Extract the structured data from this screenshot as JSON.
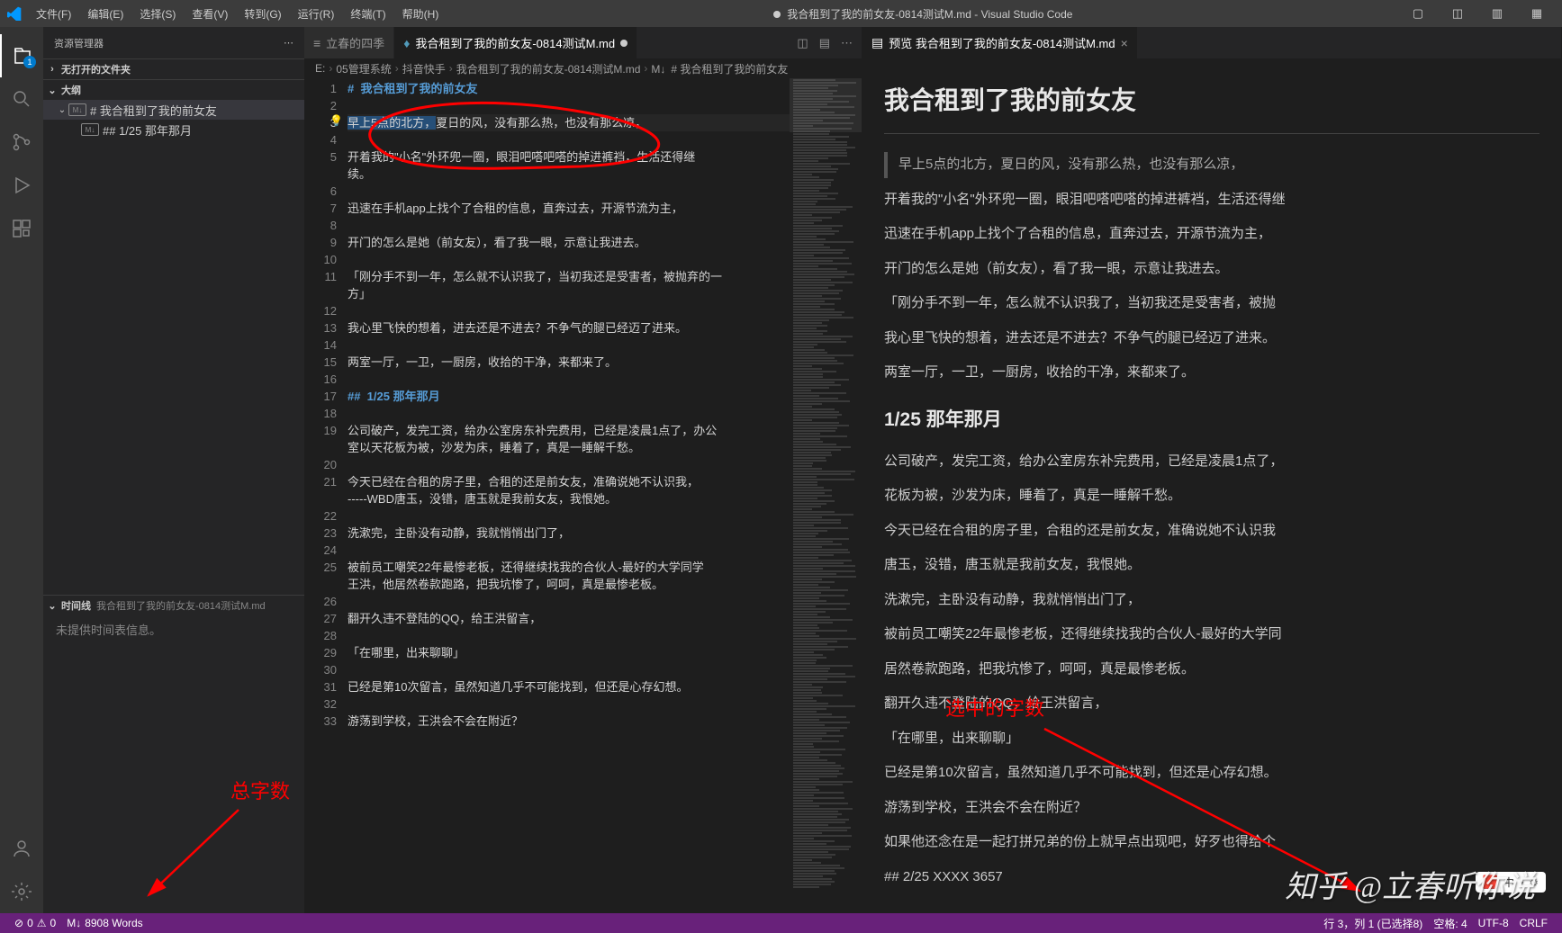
{
  "titlebar": {
    "menus": [
      "文件(F)",
      "编辑(E)",
      "选择(S)",
      "查看(V)",
      "转到(G)",
      "运行(R)",
      "终端(T)",
      "帮助(H)"
    ],
    "title": "我合租到了我的前女友-0814测试M.md - Visual Studio Code",
    "dirty": true
  },
  "activitybar": {
    "explorer_badge": "1"
  },
  "sidebar": {
    "title": "资源管理器",
    "sections": {
      "no_open_folder": "无打开的文件夹",
      "outline": "大纲",
      "timeline": "时间线",
      "timeline_file": "我合租到了我的前女友-0814测试M.md",
      "timeline_empty": "未提供时间表信息。"
    },
    "outline_items": [
      {
        "level": 0,
        "label": "# 我合租到了我的前女友"
      },
      {
        "level": 1,
        "label": "## 1/25 那年那月"
      }
    ]
  },
  "tabs": {
    "inactive": "立春的四季",
    "active": "我合租到了我的前女友-0814测试M.md",
    "preview": "预览 我合租到了我的前女友-0814测试M.md"
  },
  "breadcrumb": [
    "E:",
    "05管理系统",
    "抖音快手",
    "我合租到了我的前女友-0814测试M.md",
    "# 我合租到了我的前女友"
  ],
  "editor": {
    "lines": [
      {
        "n": 1,
        "cls": "h",
        "text": "#  我合租到了我的前女友"
      },
      {
        "n": 2,
        "text": ""
      },
      {
        "n": 3,
        "text_before": "",
        "sel": "早上5点的北方，",
        "text_after": "夏日的风，没有那么热，也没有那么凉，",
        "current": true
      },
      {
        "n": 4,
        "text": ""
      },
      {
        "n": 5,
        "text": "开着我的\"小名\"外环兜一圈，眼泪吧嗒吧嗒的掉进裤裆，生活还得继"
      },
      {
        "n": "",
        "text": "续。"
      },
      {
        "n": 6,
        "text": ""
      },
      {
        "n": 7,
        "text": "迅速在手机app上找个了合租的信息，直奔过去，开源节流为主，"
      },
      {
        "n": 8,
        "text": ""
      },
      {
        "n": 9,
        "text": "开门的怎么是她（前女友），看了我一眼，示意让我进去。"
      },
      {
        "n": 10,
        "text": ""
      },
      {
        "n": 11,
        "text": "「刚分手不到一年，怎么就不认识我了，当初我还是受害者，被抛弃的一"
      },
      {
        "n": "",
        "text": "方」"
      },
      {
        "n": 12,
        "text": ""
      },
      {
        "n": 13,
        "text": "我心里飞快的想着，进去还是不进去？不争气的腿已经迈了进来。"
      },
      {
        "n": 14,
        "text": ""
      },
      {
        "n": 15,
        "text": "两室一厅，一卫，一厨房，收拾的干净，来都来了。"
      },
      {
        "n": 16,
        "text": ""
      },
      {
        "n": 17,
        "cls": "h",
        "text": "##  1/25 那年那月"
      },
      {
        "n": 18,
        "text": ""
      },
      {
        "n": 19,
        "text": "公司破产，发完工资，给办公室房东补完费用，已经是凌晨1点了，办公"
      },
      {
        "n": "",
        "text": "室以天花板为被，沙发为床，睡着了，真是一睡解千愁。"
      },
      {
        "n": 20,
        "text": ""
      },
      {
        "n": 21,
        "text": "今天已经在合租的房子里，合租的还是前女友，准确说她不认识我，"
      },
      {
        "n": "",
        "text": "-----WBD唐玉，没错，唐玉就是我前女友，我恨她。"
      },
      {
        "n": 22,
        "text": ""
      },
      {
        "n": 23,
        "text": "洗漱完，主卧没有动静，我就悄悄出门了，"
      },
      {
        "n": 24,
        "text": ""
      },
      {
        "n": 25,
        "text": "被前员工嘲笑22年最惨老板，还得继续找我的合伙人-最好的大学同学"
      },
      {
        "n": "",
        "text": "王洪，他居然卷款跑路，把我坑惨了，呵呵，真是最惨老板。"
      },
      {
        "n": 26,
        "text": ""
      },
      {
        "n": 27,
        "text": "翻开久违不登陆的QQ，给王洪留言，"
      },
      {
        "n": 28,
        "text": ""
      },
      {
        "n": 29,
        "text": "「在哪里，出来聊聊」"
      },
      {
        "n": 30,
        "text": ""
      },
      {
        "n": 31,
        "text": "已经是第10次留言，虽然知道几乎不可能找到，但还是心存幻想。"
      },
      {
        "n": 32,
        "text": ""
      },
      {
        "n": 33,
        "text": "游荡到学校，王洪会不会在附近？"
      }
    ]
  },
  "preview": {
    "h1": "我合租到了我的前女友",
    "blockquote": "早上5点的北方，夏日的风，没有那么热，也没有那么凉，",
    "paragraphs": [
      "开着我的\"小名\"外环兜一圈，眼泪吧嗒吧嗒的掉进裤裆，生活还得继",
      "迅速在手机app上找个了合租的信息，直奔过去，开源节流为主，",
      "开门的怎么是她（前女友），看了我一眼，示意让我进去。",
      "「刚分手不到一年，怎么就不认识我了，当初我还是受害者，被抛",
      "我心里飞快的想着，进去还是不进去？不争气的腿已经迈了进来。",
      "两室一厅，一卫，一厨房，收拾的干净，来都来了。"
    ],
    "h2": "1/25 那年那月",
    "paragraphs2": [
      "公司破产，发完工资，给办公室房东补完费用，已经是凌晨1点了，",
      "花板为被，沙发为床，睡着了，真是一睡解千愁。",
      "今天已经在合租的房子里，合租的还是前女友，准确说她不认识我",
      "唐玉，没错，唐玉就是我前女友，我恨她。",
      "洗漱完，主卧没有动静，我就悄悄出门了，",
      "被前员工嘲笑22年最惨老板，还得继续找我的合伙人-最好的大学同",
      "居然卷款跑路，把我坑惨了，呵呵，真是最惨老板。",
      "翻开久违不登陆的QQ，给王洪留言，",
      "「在哪里，出来聊聊」",
      "已经是第10次留言，虽然知道几乎不可能找到，但还是心存幻想。",
      "游荡到学校，王洪会不会在附近？",
      "如果他还念在是一起打拼兄弟的份上就早点出现吧，好歹也得给个"
    ],
    "h2b": "## 2/25 XXXX 3657"
  },
  "statusbar": {
    "errors": "0",
    "warnings": "0",
    "words": "8908 Words",
    "cursor": "行 3，列 1 (已选择8)",
    "spaces": "空格: 4",
    "encoding": "UTF-8",
    "eol": "CRLF"
  },
  "annotations": {
    "total_words": "总字数",
    "selected_words": "选中的字数"
  },
  "watermark": "知乎 @立春听你说",
  "floatbox": {
    "lang": "中"
  }
}
